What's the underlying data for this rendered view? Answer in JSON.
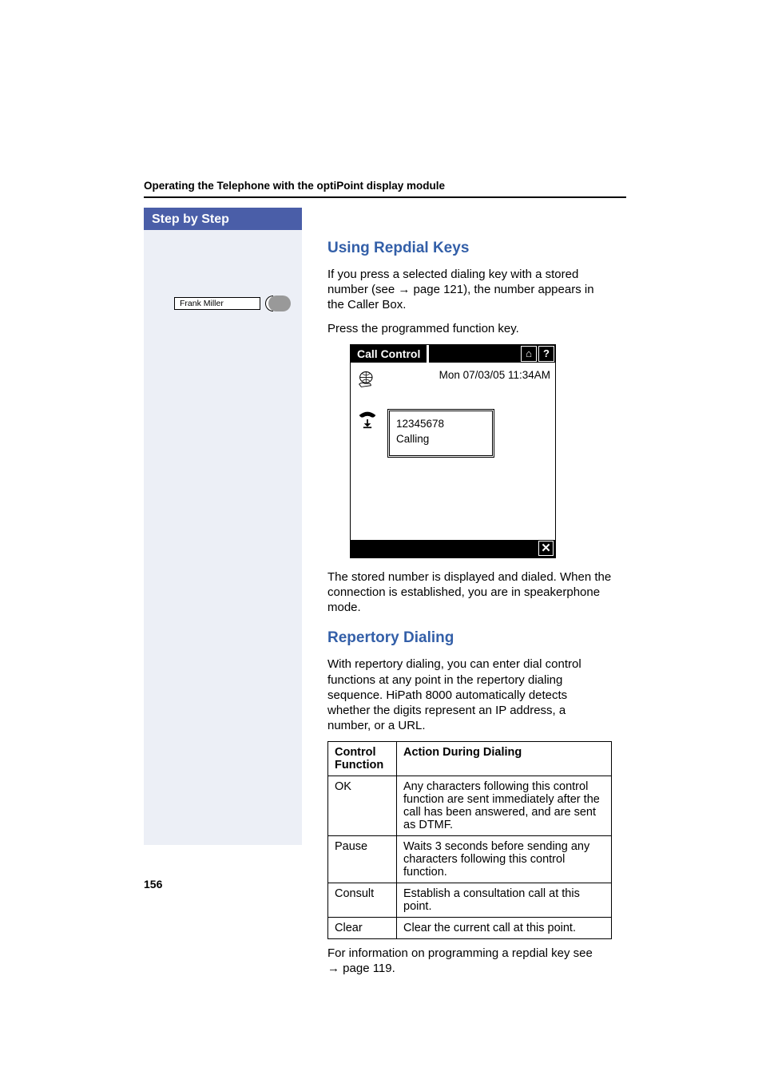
{
  "running_head": "Operating the Telephone with the optiPoint display module",
  "sidebar_title": "Step by Step",
  "function_key_label": "Frank Miller",
  "section1": {
    "heading": "Using Repdial Keys",
    "p1a": "If you press a selected dialing key with a stored number (see ",
    "p1_arrow": "→",
    "p1b": " page 121), the number appears in the Caller Box.",
    "p2": "Press the programmed function key.",
    "p3": "The stored number is displayed and dialed. When the connection is established, you are in speakerphone mode."
  },
  "screen": {
    "title": "Call Control",
    "home_icon": "⌂",
    "help_icon": "?",
    "datetime": "Mon 07/03/05 11:34AM",
    "number": "12345678",
    "status": "Calling",
    "close_icon": "✕"
  },
  "section2": {
    "heading": "Repertory Dialing",
    "p1": "With repertory dialing, you can enter dial control functions at any point in the repertory dialing sequence. HiPath 8000 automatically detects whether the digits represent an IP address, a number, or a URL.",
    "table": {
      "h1": "Control Function",
      "h2": "Action During Dialing",
      "rows": [
        {
          "c1": "OK",
          "c2": "Any characters following this control function are sent immediately after the call has been answered, and are sent as DTMF."
        },
        {
          "c1": "Pause",
          "c2": "Waits 3 seconds before sending any characters following this control function."
        },
        {
          "c1": "Consult",
          "c2": "Establish a consultation call at this point."
        },
        {
          "c1": "Clear",
          "c2": "Clear the current call at this point."
        }
      ]
    },
    "foot_a": "For information on programming a repdial key see ",
    "foot_arrow": "→",
    "foot_b": " page 119."
  },
  "page_number": "156"
}
